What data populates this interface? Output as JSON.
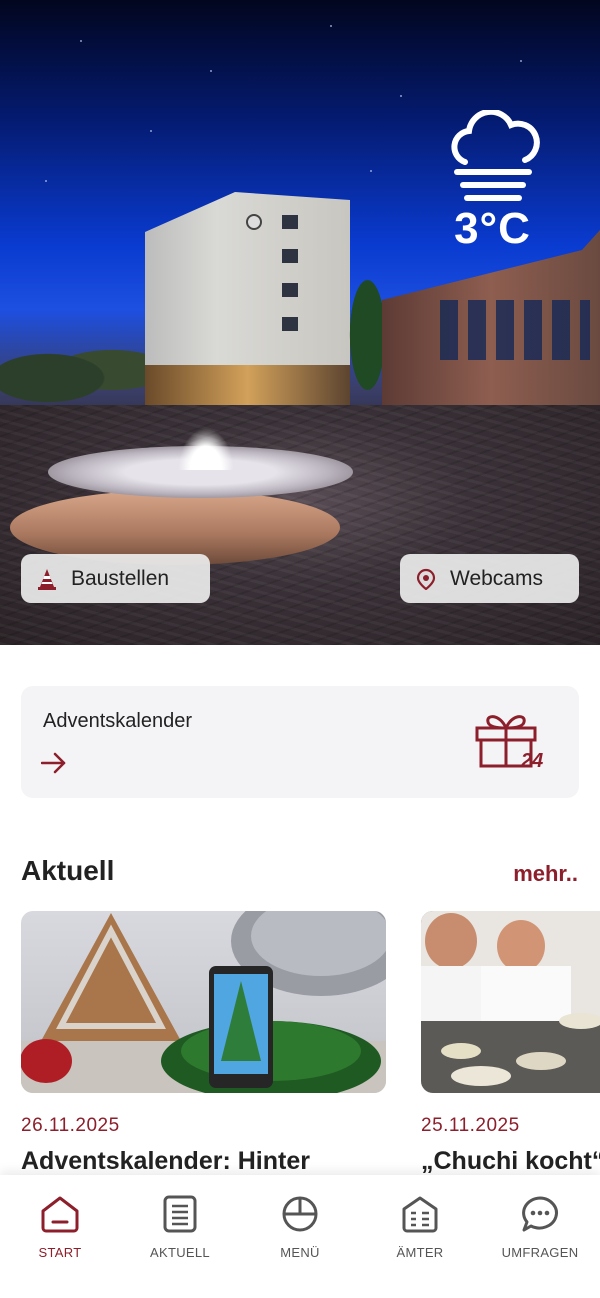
{
  "hero": {
    "weather": {
      "icon": "fog-cloud-icon",
      "temperature": "3°C"
    },
    "chips": [
      {
        "label": "Baustellen",
        "icon": "traffic-cone-icon"
      },
      {
        "label": "Webcams",
        "icon": "webcam-pin-icon"
      }
    ]
  },
  "advent": {
    "title": "Adventskalender",
    "icon": "gift-icon",
    "badge": "24",
    "arrow_icon": "arrow-right-icon"
  },
  "aktuell": {
    "title": "Aktuell",
    "more_label": "mehr..",
    "items": [
      {
        "date": "26.11.2025",
        "title": "Adventskalender: Hinter"
      },
      {
        "date": "25.11.2025",
        "title": "„Chuchi kocht“"
      }
    ]
  },
  "nav": {
    "items": [
      {
        "label": "START",
        "icon": "home-icon",
        "active": true
      },
      {
        "label": "AKTUELL",
        "icon": "news-list-icon",
        "active": false
      },
      {
        "label": "MENÜ",
        "icon": "menu-circle-icon",
        "active": false
      },
      {
        "label": "ÄMTER",
        "icon": "offices-icon",
        "active": false
      },
      {
        "label": "UMFRAGEN",
        "icon": "chat-bubble-icon",
        "active": false
      }
    ]
  },
  "colors": {
    "accent": "#8c1f2b",
    "card_bg": "#f4f3f6",
    "text": "#222222"
  }
}
